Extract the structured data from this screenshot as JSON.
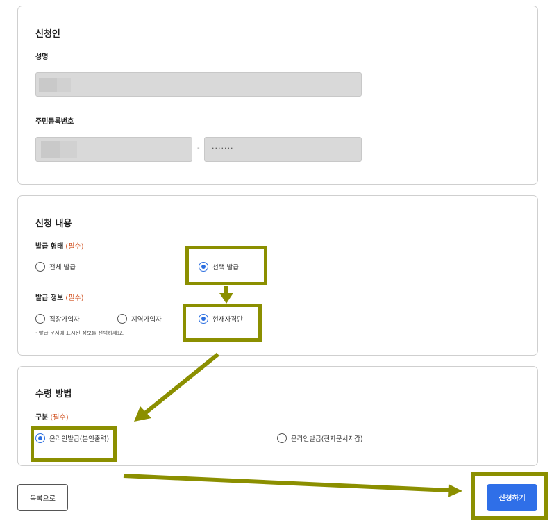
{
  "applicant": {
    "title": "신청인",
    "name_label": "성명",
    "rrn_label": "주민등록번호",
    "rrn_separator": "-",
    "rrn_back_mask": "·······"
  },
  "request": {
    "title": "신청 내용",
    "issue_type_label": "발급 형태",
    "issue_type_required": "(필수)",
    "issue_type_options": [
      {
        "label": "전체 발급",
        "selected": false
      },
      {
        "label": "선택 발급",
        "selected": true
      }
    ],
    "issue_info_label": "발급 정보",
    "issue_info_required": "(필수)",
    "issue_info_options": [
      {
        "label": "직장가입자",
        "selected": false
      },
      {
        "label": "지역가입자",
        "selected": false
      },
      {
        "label": "현재자격만",
        "selected": true
      }
    ],
    "issue_info_hint": "· 발급 문서에 표시된 정보를 선택하세요."
  },
  "receipt": {
    "title": "수령 방법",
    "category_label": "구분",
    "category_required": "(필수)",
    "category_options": [
      {
        "label": "온라인발급(본인출력)",
        "selected": true
      },
      {
        "label": "온라인발급(전자문서지갑)",
        "selected": false
      }
    ]
  },
  "actions": {
    "list_label": "목록으로",
    "submit_label": "신청하기"
  },
  "colors": {
    "accent": "#2f6fe8",
    "highlight": "#8b8f00",
    "required": "#d0501f"
  }
}
